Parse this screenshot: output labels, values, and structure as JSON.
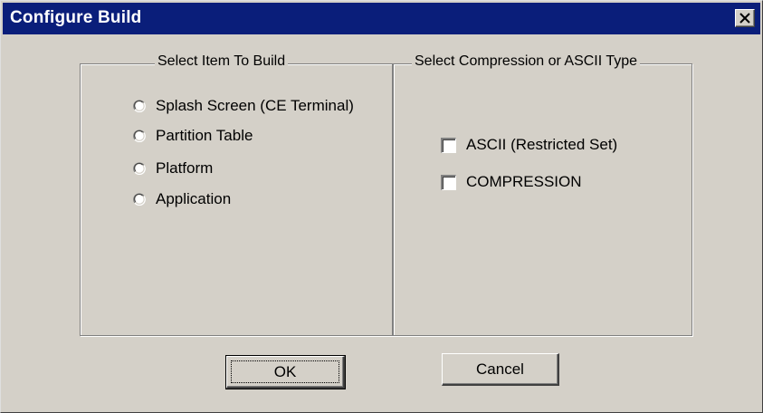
{
  "window": {
    "title": "Configure Build"
  },
  "groups": {
    "item": {
      "legend": "Select Item To Build",
      "options": [
        {
          "label": "Splash Screen (CE Terminal)",
          "selected": false
        },
        {
          "label": "Partition Table",
          "selected": false
        },
        {
          "label": "Platform",
          "selected": false
        },
        {
          "label": "Application",
          "selected": false
        }
      ]
    },
    "type": {
      "legend": "Select Compression or ASCII Type",
      "options": [
        {
          "label": "ASCII (Restricted Set)",
          "checked": false
        },
        {
          "label": "COMPRESSION",
          "checked": false
        }
      ]
    }
  },
  "buttons": {
    "ok": "OK",
    "cancel": "Cancel"
  },
  "icons": {
    "close": "close-icon",
    "radio": "radio-button-icon",
    "checkbox": "checkbox-icon"
  },
  "colors": {
    "titlebar": "#0a1e7a",
    "face": "#d4d0c8"
  }
}
